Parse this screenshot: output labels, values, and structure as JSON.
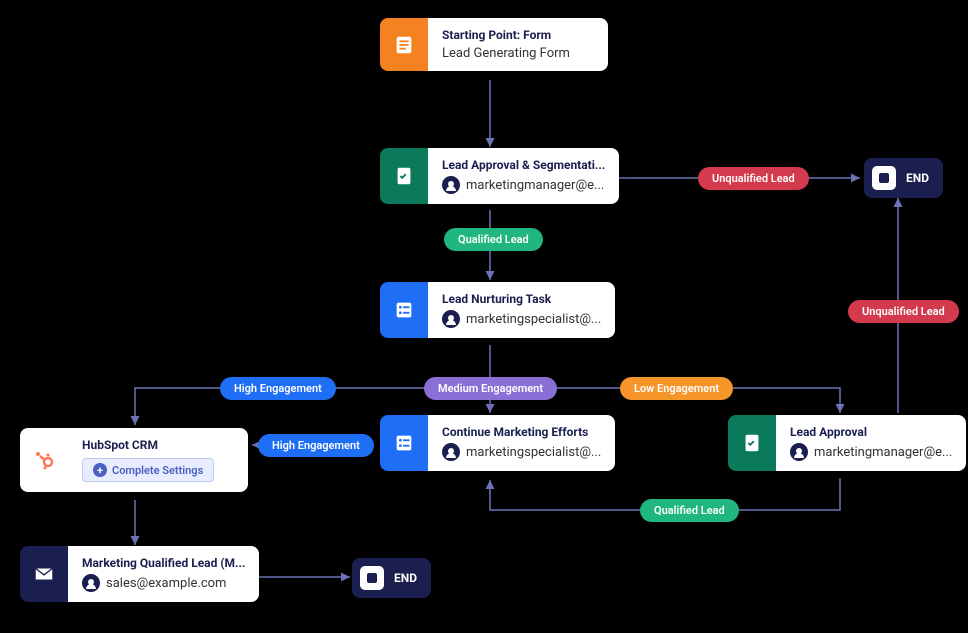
{
  "nodes": {
    "start": {
      "title": "Starting Point: Form",
      "subtitle": "Lead Generating Form"
    },
    "approval": {
      "title": "Lead Approval & Segmentati...",
      "assignee": "marketingmanager@e..."
    },
    "nurturing": {
      "title": "Lead Nurturing Task",
      "assignee": "marketingspecialist@..."
    },
    "hubspot": {
      "title": "HubSpot CRM",
      "button": "Complete Settings"
    },
    "continue": {
      "title": "Continue Marketing Efforts",
      "assignee": "marketingspecialist@..."
    },
    "leadApproval2": {
      "title": "Lead Approval",
      "assignee": "marketingmanager@e..."
    },
    "mql": {
      "title": "Marketing Qualified Lead (M...",
      "assignee": "sales@example.com"
    },
    "end1": {
      "label": "END"
    },
    "end2": {
      "label": "END"
    }
  },
  "pills": {
    "qualified1": "Qualified Lead",
    "unqualified1": "Unqualified Lead",
    "unqualified2": "Unqualified Lead",
    "highEng1": "High Engagement",
    "highEng2": "High Engagement",
    "medEng": "Medium Engagement",
    "lowEng": "Low Engagement",
    "qualified2": "Qualified Lead"
  },
  "colors": {
    "orange": "#f58220",
    "green": "#0a7a5a",
    "blue": "#1e6ff5",
    "navy": "#1a1f4f",
    "pillGreen": "#1fb67f",
    "pillRed": "#d43a4e",
    "pillBlue": "#1e6ff5",
    "pillPurple": "#8a6fd6",
    "pillOrange": "#f5952a",
    "line": "#6b72b5"
  }
}
